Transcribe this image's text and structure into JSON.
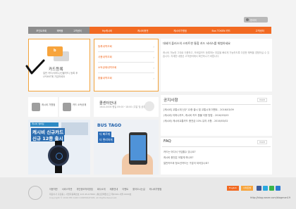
{
  "top": {
    "links": [
      "로그인",
      "회원가입",
      "고객센터"
    ],
    "lang_label": "한국어"
  },
  "nav": {
    "grey_items": [
      "포인트조회",
      "혜택몰",
      "고객센터"
    ],
    "orange_items": [
      "My캐시비",
      "캐시비충전",
      "캐시비가맹점",
      "Bus TOKEN 카드",
      "고객센터"
    ]
  },
  "card": {
    "icon_letter": "b",
    "title": "카드등록",
    "desc": "일반 카드(티머니/선불카드) 등록 후 LPOINT에 가입하세요"
  },
  "menu": {
    "items": [
      "등록내역조회",
      "사용내역조회",
      "소득공제내역조회",
      "환불내역조회"
    ]
  },
  "intro": {
    "headline": "대세이 플러스의 스마트한 통합 카드 서비스를 체험하세요",
    "body": "캐시비 가능한 그대로 이용하고, 모바일카드 등록하는 부분을 빠르게 가능하도록 다양한 혜택을 경험하실 수 있습니다. 자세한 내용은 고객센터에서 확인하시기 바랍니다."
  },
  "quick": [
    {
      "label": "캐시비 가맹점"
    },
    {
      "label": "카드 소득공제"
    }
  ],
  "call_center": {
    "title": "콜센터안내",
    "sub": "1644-0006 평일 09:00~18:00 (주말 및 공휴일 휴무)"
  },
  "promo_watch": {
    "head": "캐시비 멤버십",
    "line1": "캐시비 신규카드",
    "line2": "신규 12종 출시"
  },
  "promo_bus": {
    "logo": "BUS TAGO",
    "tag1": "더 빠르게",
    "tag2": "더 편리하게"
  },
  "notice": {
    "title": "공지사항",
    "more": "more",
    "items": [
      "[캐시비] 교통시계 신규 12종 출시 및 교통시계 이벤트 - 2016/03/09",
      "(캐시비) 티머니카드, 캐시비 카드 환불 이용 방법 - 2016/03/03",
      "(캐시비) 캐시비교통카드 충전금 10% 유의 사항 - 2016/03/02"
    ]
  },
  "faq": {
    "title": "FAQ",
    "more": "more",
    "items": [
      "카드는 어디서 구입할수 있나요?",
      "캐시비 충전은 어떻게 하나요?",
      "일반카드와 청소년카드는 구분이 되어있나요?"
    ]
  },
  "footer": {
    "links": [
      "이용약관",
      "서비스약관",
      "개인정보처리방침",
      "회사소개",
      "제휴안내",
      "이벤트",
      "찾아오시는길",
      "캐시비가맹점"
    ],
    "info": "대표이사 홍길동 | 사업자등록번호 123-45-67890 | 통신판매업신고 제2016-서울-0000호",
    "copy": "Copyright © 2016 EB CARD CORPORATION. All Rights Reserved.",
    "btn1": "English",
    "btn2": "사이트맵"
  },
  "blog_url": "http://blog.naver.com/blogman19"
}
